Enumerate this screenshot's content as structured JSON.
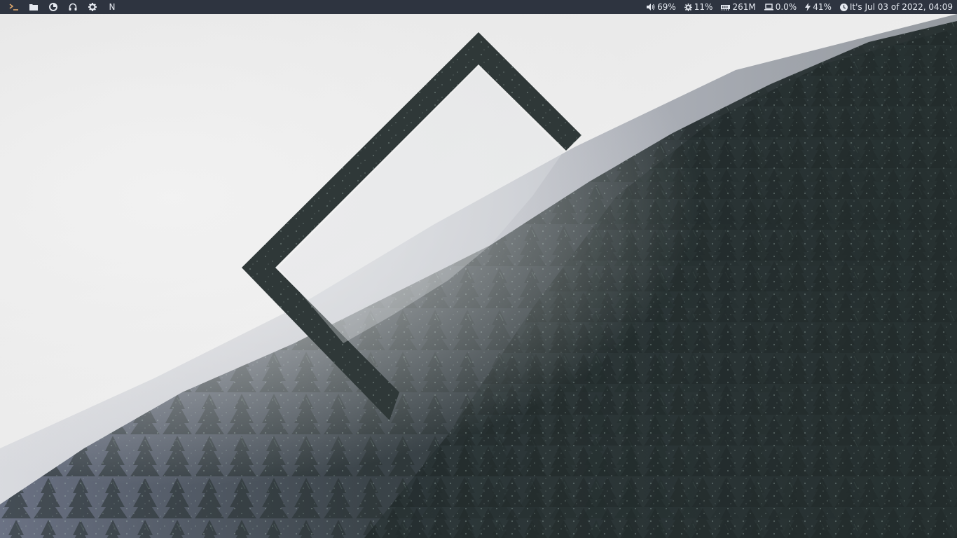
{
  "topbar": {
    "launchers": [
      {
        "icon": "terminal-icon",
        "label": ""
      },
      {
        "icon": "folder-icon",
        "label": ""
      },
      {
        "icon": "browser-icon",
        "label": ""
      },
      {
        "icon": "headphones-icon",
        "label": ""
      },
      {
        "icon": "settings-icon",
        "label": ""
      },
      {
        "icon": "notes-icon",
        "label": "N"
      }
    ],
    "status": {
      "volume": "69%",
      "cpu": "11%",
      "memory": "261M",
      "disk": "0.0%",
      "battery": "41%",
      "datetime": "It's Jul 03 of 2022, 04:09"
    }
  },
  "colors": {
    "bar_bg": "#2e3440",
    "bar_text": "#e5e9f0",
    "accent_orange": "#e0a96d",
    "fog": "#ececec",
    "forest_dark": "#2a3333"
  }
}
